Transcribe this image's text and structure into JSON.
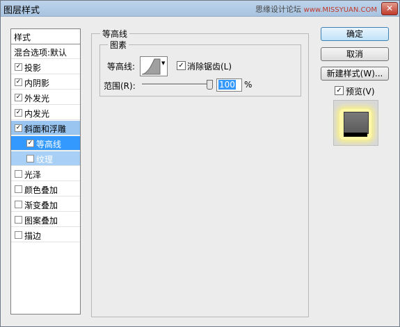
{
  "window": {
    "title": "图层样式",
    "watermark": "思缘设计论坛",
    "watermark_url": "www.MISSYUAN.COM",
    "close_glyph": "✕"
  },
  "styles_list": {
    "header": "样式",
    "blend": "混合选项:默认",
    "items": [
      {
        "label": "投影",
        "checked": true,
        "check": "✓"
      },
      {
        "label": "内阴影",
        "checked": true,
        "check": "✓"
      },
      {
        "label": "外发光",
        "checked": true,
        "check": "✓"
      },
      {
        "label": "内发光",
        "checked": true,
        "check": "✓"
      },
      {
        "label": "斜面和浮雕",
        "checked": true,
        "check": "✓"
      },
      {
        "label": "等高线",
        "checked": true,
        "check": "✓"
      },
      {
        "label": "纹理",
        "checked": false,
        "check": ""
      },
      {
        "label": "光泽",
        "checked": false,
        "check": ""
      },
      {
        "label": "颜色叠加",
        "checked": false,
        "check": ""
      },
      {
        "label": "渐变叠加",
        "checked": false,
        "check": ""
      },
      {
        "label": "图案叠加",
        "checked": false,
        "check": ""
      },
      {
        "label": "描边",
        "checked": false,
        "check": ""
      }
    ]
  },
  "contour_panel": {
    "group_title": "等高线",
    "sub_title": "图素",
    "contour_label": "等高线:",
    "anti_alias_label": "消除锯齿(L)",
    "anti_alias_checked": true,
    "check": "✓",
    "range_label": "范围(R):",
    "range_value": "100",
    "range_unit": "%",
    "range_fraction": 1.0
  },
  "buttons": {
    "ok": "确定",
    "cancel": "取消",
    "new_style": "新建样式(W)...",
    "preview_label": "预览(V)",
    "preview_checked": true
  }
}
